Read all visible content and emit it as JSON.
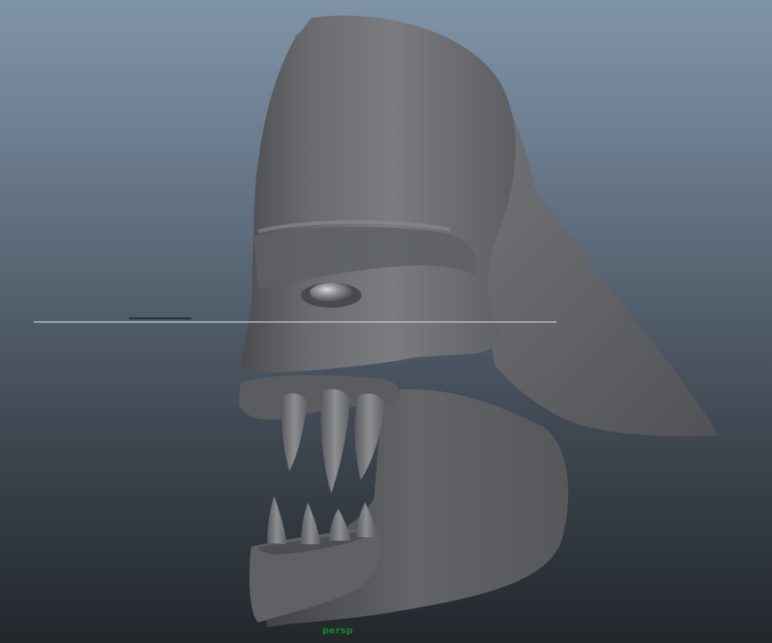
{
  "viewport": {
    "camera_label": "persp",
    "label_color": "#178a25",
    "background_top": "#7f93a8",
    "background_bottom": "#23272c",
    "model_color": "#6b6d70"
  }
}
